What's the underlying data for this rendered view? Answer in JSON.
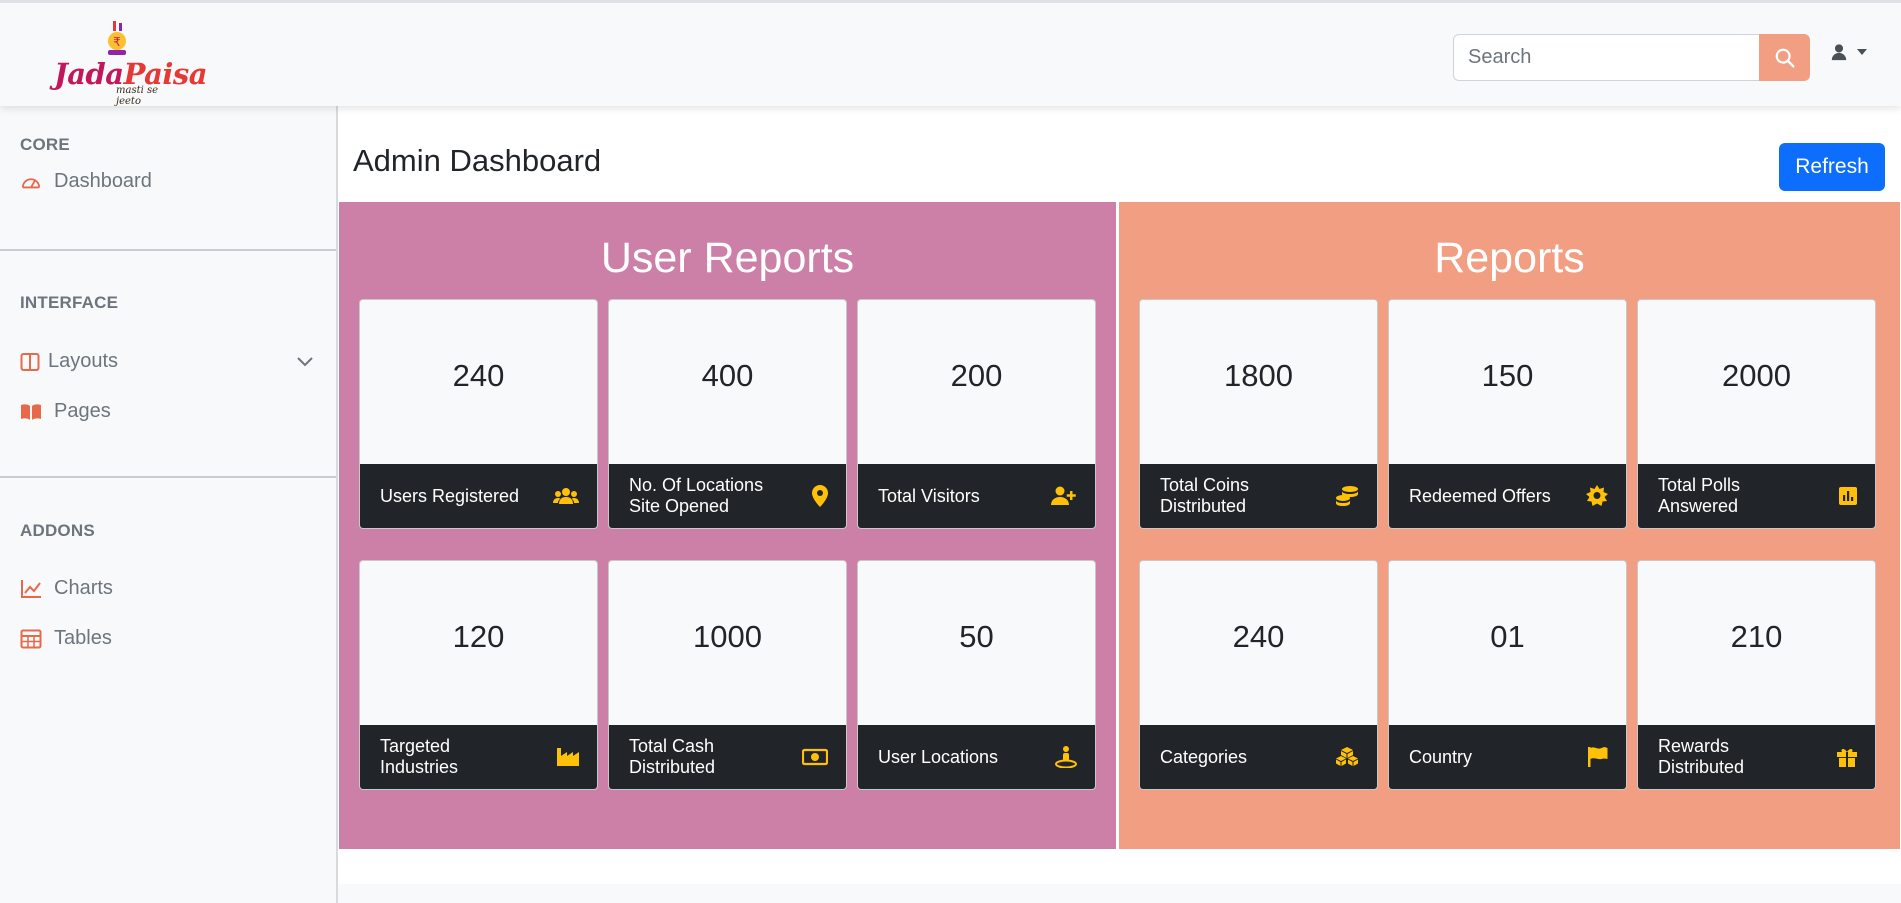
{
  "brand": {
    "name_part1": "Jada",
    "name_part2": "Paisa",
    "tagline": "masti se jeeto"
  },
  "search": {
    "placeholder": "Search",
    "value": ""
  },
  "sidebar": {
    "sections": [
      {
        "heading": "CORE",
        "items": [
          {
            "label": "Dashboard",
            "icon": "tachometer-icon"
          }
        ]
      },
      {
        "heading": "INTERFACE",
        "items": [
          {
            "label": "Layouts",
            "icon": "columns-icon",
            "expandable": true
          },
          {
            "label": "Pages",
            "icon": "book-open-icon"
          }
        ]
      },
      {
        "heading": "ADDONS",
        "items": [
          {
            "label": "Charts",
            "icon": "chart-line-icon"
          },
          {
            "label": "Tables",
            "icon": "table-icon"
          }
        ]
      }
    ]
  },
  "main": {
    "title": "Admin Dashboard",
    "refresh_label": "Refresh",
    "panels": [
      {
        "title": "User Reports",
        "color": "#cc80a8",
        "cards": [
          {
            "value": "240",
            "label": "Users Registered",
            "icon": "users-icon"
          },
          {
            "value": "400",
            "label": "No. Of Locations Site Opened",
            "icon": "map-pin-icon"
          },
          {
            "value": "200",
            "label": "Total Visitors",
            "icon": "user-plus-icon"
          },
          {
            "value": "120",
            "label": "Targeted Industries",
            "icon": "industry-icon"
          },
          {
            "value": "1000",
            "label": "Total Cash Distributed",
            "icon": "money-bill-icon"
          },
          {
            "value": "50",
            "label": "User Locations",
            "icon": "street-view-icon"
          }
        ]
      },
      {
        "title": "Reports",
        "color": "#f19e82",
        "cards": [
          {
            "value": "1800",
            "label": "Total Coins Distributed",
            "icon": "coins-icon"
          },
          {
            "value": "150",
            "label": "Redeemed Offers",
            "icon": "certificate-icon"
          },
          {
            "value": "2000",
            "label": "Total Polls Answered",
            "icon": "poll-icon"
          },
          {
            "value": "240",
            "label": "Categories",
            "icon": "cubes-icon"
          },
          {
            "value": "01",
            "label": "Country",
            "icon": "flag-icon"
          },
          {
            "value": "210",
            "label": "Rewards Distributed",
            "icon": "gift-icon"
          }
        ]
      }
    ]
  },
  "colors": {
    "accent": "#f19e82",
    "pink_panel": "#cc80a8",
    "primary_button": "#0d6efd",
    "card_footer": "#212529",
    "icon_yellow": "#ffc107"
  }
}
